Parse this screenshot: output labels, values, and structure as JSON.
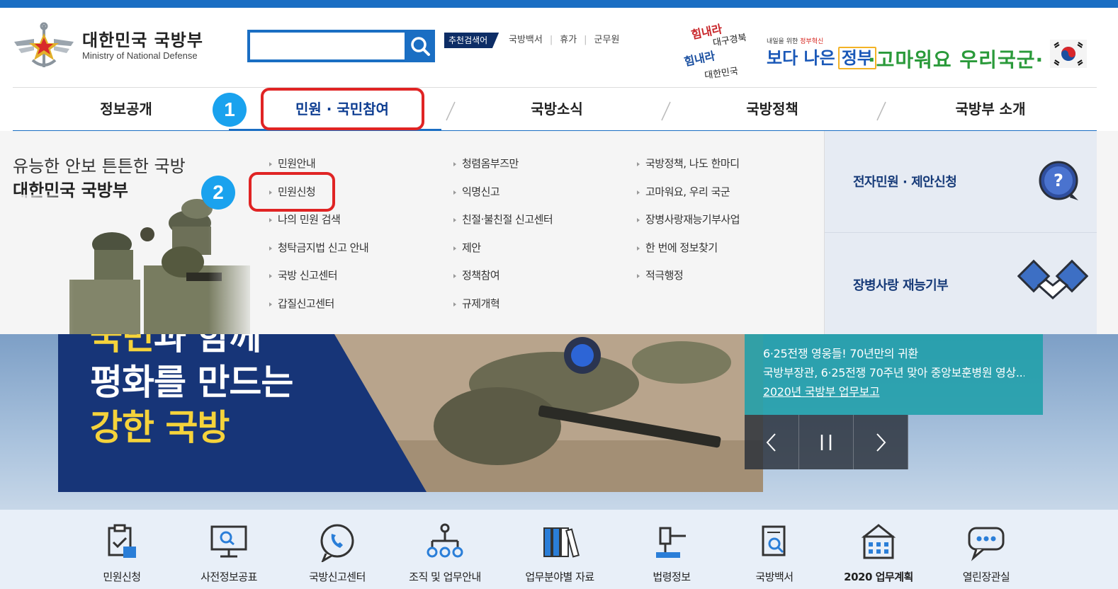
{
  "header": {
    "logo_ko": "대한민국 국방부",
    "logo_en": "Ministry of National Defense",
    "search": {
      "value": "",
      "placeholder": ""
    },
    "recommended_label": "추천검색어",
    "recommended": [
      "국방백서",
      "휴가",
      "군무원"
    ],
    "promo": {
      "slogan_lines": [
        "힘내라",
        "대구경북",
        "힘내라",
        "대한민국"
      ],
      "small": "내일을 위한",
      "small_red": "정부혁신",
      "big1": "보다 나은",
      "big2": "정부",
      "thanks": "·고마워요 우리국군·"
    }
  },
  "nav": {
    "items": [
      "정보공개",
      "민원 · 국민참여",
      "국방소식",
      "국방정책",
      "국방부 소개"
    ],
    "active_index": 1
  },
  "badges": [
    "1",
    "2"
  ],
  "dropdown": {
    "title_line1": "유능한 안보 튼튼한 국방",
    "title_line2": "대한민국 국방부",
    "col1": [
      "민원안내",
      "민원신청",
      "나의 민원 검색",
      "청탁금지법 신고 안내",
      "국방 신고센터",
      "갑질신고센터"
    ],
    "col2": [
      "청렴옴부즈만",
      "익명신고",
      "친절·불친절 신고센터",
      "제안",
      "정책참여",
      "규제개혁"
    ],
    "col3": [
      "국방정책, 나도 한마디",
      "고마워요, 우리 국군",
      "장병사랑재능기부사업",
      "한 번에 정보찾기",
      "적극행정"
    ],
    "right": [
      "전자민원 · 제안신청",
      "장병사랑 재능기부"
    ]
  },
  "banner": {
    "line1_a": "국민",
    "line1_b": "과 함께",
    "line2": "평화를 만드는",
    "line3": "강한 국방",
    "news": [
      "6·25전쟁 영웅들! 70년만의 귀환",
      "국방부장관, 6·25전쟁 70주년 맞아 중앙보훈병원 영상...",
      "2020년 국방부 업무보고"
    ]
  },
  "quick": [
    "민원신청",
    "사전정보공표",
    "국방신고센터",
    "조직 및 업무안내",
    "업무분야별 자료",
    "법령정보",
    "국방백서",
    "2020 업무계획",
    "열린장관실"
  ],
  "colors": {
    "primary": "#1a6ec3",
    "navy": "#0d2d66",
    "highlight": "#e02424",
    "badge": "#1aa2ee",
    "teal": "#1f9faa"
  }
}
